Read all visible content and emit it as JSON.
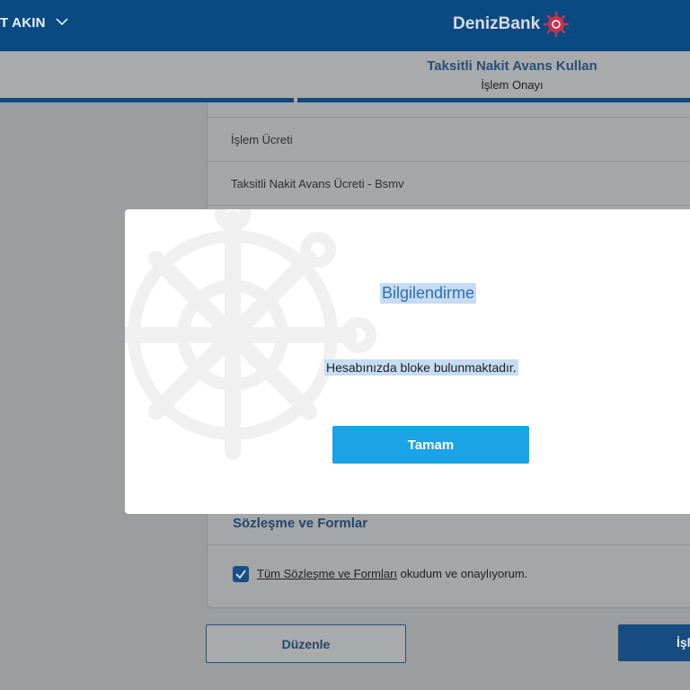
{
  "header": {
    "user_name": "T AKIN",
    "brand": "DenizBank"
  },
  "page": {
    "title": "Taksitli Nakit Avans Kullan",
    "step": "İşlem Onayı"
  },
  "details": {
    "rows": [
      {
        "label": "İşlem Ücreti"
      },
      {
        "label": "Taksitli Nakit Avans Ücreti - Bsmv"
      }
    ]
  },
  "contracts": {
    "section_title": "Sözleşme ve Formlar",
    "link_text": "Tüm Sözleşme ve Formları",
    "consent_rest": " okudum ve onaylıyorum.",
    "checked": true
  },
  "actions": {
    "edit_label": "Düzenle",
    "next_label": "İşl"
  },
  "modal": {
    "title": "Bilgilendirme",
    "message": "Hesabınızda bloke bulunmaktadır.",
    "ok_label": "Tamam"
  },
  "colors": {
    "header_bg": "#0a4a82",
    "modal_button": "#1aa3e6",
    "title_blue": "#2f6fb0"
  }
}
